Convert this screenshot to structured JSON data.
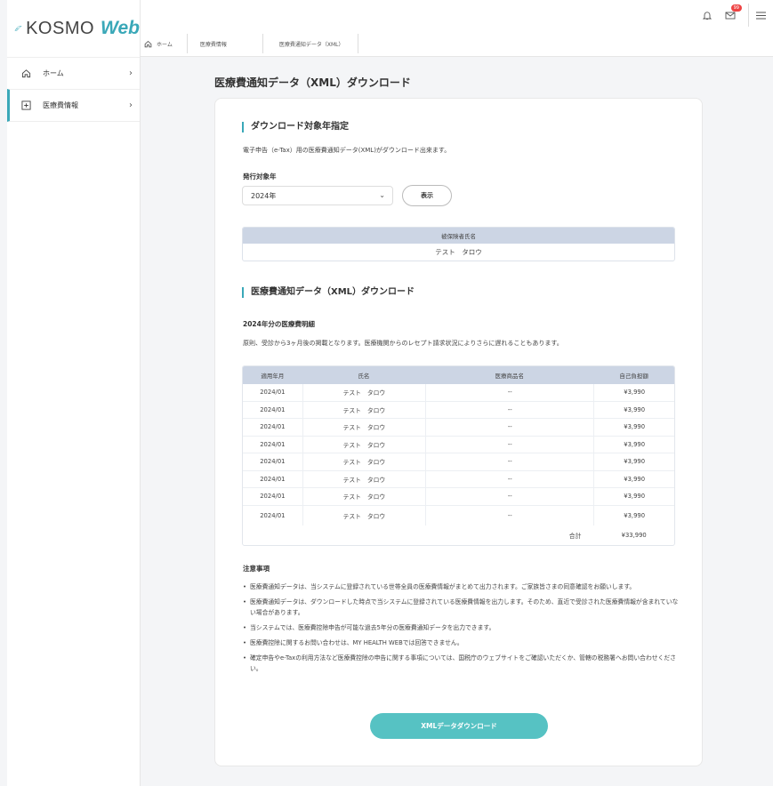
{
  "app": {
    "logo_text": "KOSMO",
    "logo_web": "Web"
  },
  "sidebar": {
    "items": [
      {
        "label": "ホーム",
        "icon": "home-icon",
        "active": false
      },
      {
        "label": "医療費情報",
        "icon": "plus-square-icon",
        "active": true
      }
    ]
  },
  "breadcrumb": [
    "ホーム",
    "医療費情報",
    "医療費通知データ（XML）"
  ],
  "header": {
    "notification_badge": "99"
  },
  "page_title": "医療費通知データ（XML）ダウンロード",
  "download_year": {
    "section_title": "ダウンロード対象年指定",
    "description": "電子申告（e-Tax）用の医療費通知データ(XML)がダウンロード出来ます。",
    "year_label": "発行対象年",
    "year_value": "2024年",
    "show_button": "表示",
    "insured_header": "被保険者氏名",
    "insured_name": "テスト　タロウ"
  },
  "xml_download": {
    "section_title": "医療費通知データ（XML）ダウンロード",
    "detail_title": "2024年分の医療費明細",
    "description": "原則、受診から3ヶ月後の掲載となります。医療機関からのレセプト請求状況によりさらに遅れることもあります。",
    "table": {
      "headers": [
        "適用年月",
        "氏名",
        "医療商品名",
        "自己負担額"
      ],
      "rows": [
        [
          "2024/01",
          "テスト　タロウ",
          "--",
          "¥3,990"
        ],
        [
          "2024/01",
          "テスト　タロウ",
          "--",
          "¥3,990"
        ],
        [
          "2024/01",
          "テスト　タロウ",
          "--",
          "¥3,990"
        ],
        [
          "2024/01",
          "テスト　タロウ",
          "--",
          "¥3,990"
        ],
        [
          "2024/01",
          "テスト　タロウ",
          "--",
          "¥3,990"
        ],
        [
          "2024/01",
          "テスト　タロウ",
          "--",
          "¥3,990"
        ],
        [
          "2024/01",
          "テスト　タロウ",
          "--",
          "¥3,990"
        ],
        [
          "2024/01",
          "テスト　タロウ",
          "--",
          "¥3,990"
        ]
      ],
      "total_label": "合計",
      "total_value": "¥33,990"
    }
  },
  "notes": {
    "title": "注意事項",
    "items": [
      "医療費通知データは、当システムに登録されている世帯全員の医療費情報がまとめて出力されます。ご家族皆さまの同意確認をお願いします。",
      "医療費通知データは、ダウンロードした時点で当システムに登録されている医療費情報を出力します。そのため、直近で受診された医療費情報が含まれていない場合があります。",
      "当システムでは、医療費控除申告が可能な過去5年分の医療費通知データを出力できます。",
      "医療費控除に関するお問い合わせは、MY HEALTH WEBでは回答できません。",
      "確定申告やe-Taxの利用方法など医療費控除の申告に関する事項については、国税庁のウェブサイトをご確認いただくか、管轄の税務署へお問い合わせください。"
    ]
  },
  "download_button": "XMLデータダウンロード",
  "colors": {
    "accent": "#3aa8b8",
    "button": "#56c2c3",
    "table_header": "#ccd5e4"
  }
}
